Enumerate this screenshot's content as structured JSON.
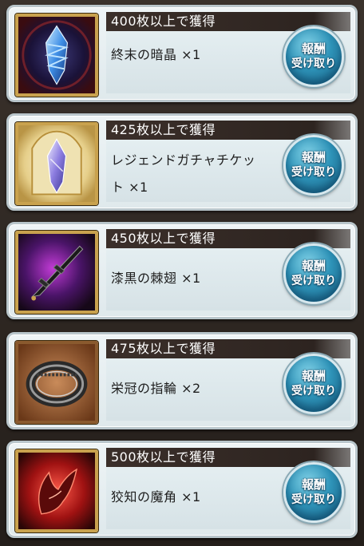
{
  "rewards": [
    {
      "header": "400枚以上で獲得",
      "item_line1": "終末の暗晶 ×1",
      "item_line2": "",
      "icon": "dark-crystal-icon",
      "button_line1": "報酬",
      "button_line2": "受け取り"
    },
    {
      "header": "425枚以上で獲得",
      "item_line1": "レジェンドガチャチケッ",
      "item_line2": "ト ×1",
      "icon": "legend-gacha-ticket-icon",
      "button_line1": "報酬",
      "button_line2": "受け取り"
    },
    {
      "header": "450枚以上で獲得",
      "item_line1": "漆黒の棘翅 ×1",
      "item_line2": "",
      "icon": "black-thorn-wing-icon",
      "button_line1": "報酬",
      "button_line2": "受け取り"
    },
    {
      "header": "475枚以上で獲得",
      "item_line1": "栄冠の指輪 ×2",
      "item_line2": "",
      "icon": "ring-icon",
      "button_line1": "報酬",
      "button_line2": "受け取り"
    },
    {
      "header": "500枚以上で獲得",
      "item_line1": "狡知の魔角 ×1",
      "item_line2": "",
      "icon": "demon-horn-icon",
      "button_line1": "報酬",
      "button_line2": "受け取り"
    }
  ],
  "colors": {
    "header_bg": "#3b2f2a",
    "button_blue": "#2e93b8",
    "frame_gold": "#c9a24e",
    "card_bg": "#e4eef1"
  }
}
